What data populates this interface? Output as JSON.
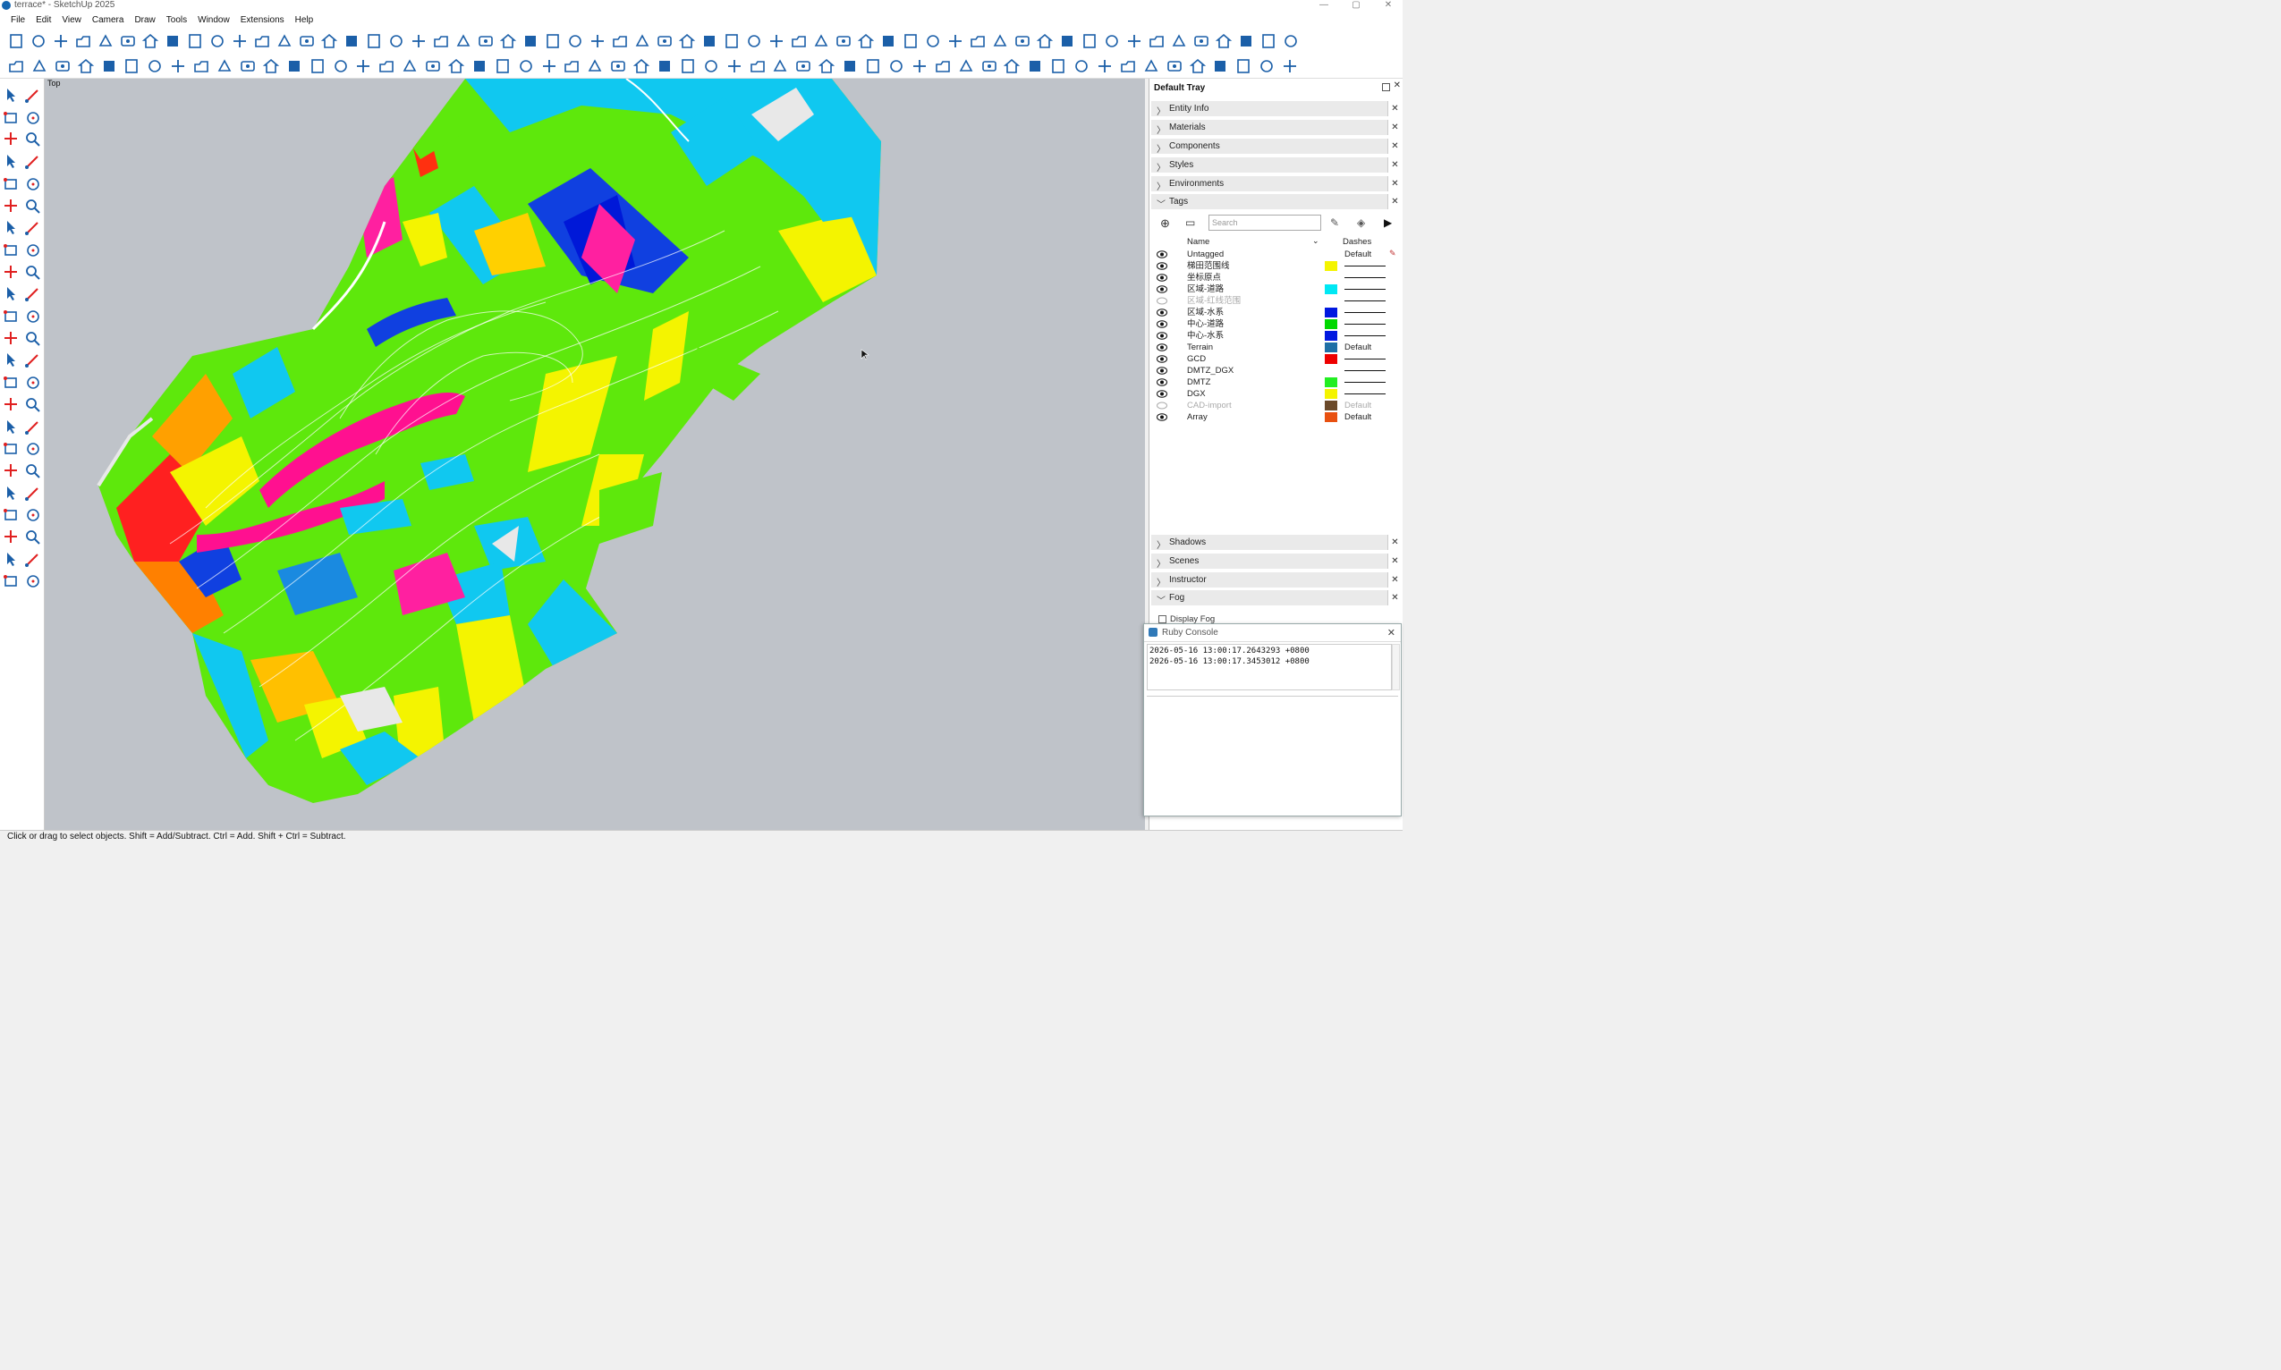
{
  "window": {
    "title": "terrace* - SketchUp 2025"
  },
  "menu": [
    "File",
    "Edit",
    "View",
    "Camera",
    "Draw",
    "Tools",
    "Window",
    "Extensions",
    "Help"
  ],
  "viewport": {
    "view_label": "Top"
  },
  "tray": {
    "title": "Default Tray",
    "panels_top": [
      "Entity Info",
      "Materials",
      "Components",
      "Styles",
      "Environments"
    ],
    "tags_panel": "Tags",
    "search_placeholder": "Search",
    "col_name": "Name",
    "col_dashes": "Dashes",
    "tags": [
      {
        "name": "Untagged",
        "visible": true,
        "color": "",
        "dashes": "Default"
      },
      {
        "name": "梯田范围线",
        "visible": true,
        "color": "#f4f400",
        "dashes": ""
      },
      {
        "name": "坐标原点",
        "visible": true,
        "color": "",
        "dashes": ""
      },
      {
        "name": "区域-道路",
        "visible": true,
        "color": "#00e8f4",
        "dashes": ""
      },
      {
        "name": "区域-红线范围",
        "visible": false,
        "color": "",
        "dashes": ""
      },
      {
        "name": "区域-水系",
        "visible": true,
        "color": "#0018e0",
        "dashes": ""
      },
      {
        "name": "中心-道路",
        "visible": true,
        "color": "#00d800",
        "dashes": ""
      },
      {
        "name": "中心-水系",
        "visible": true,
        "color": "#0018e0",
        "dashes": ""
      },
      {
        "name": "Terrain",
        "visible": true,
        "color": "#1e6fa6",
        "dashes": "Default"
      },
      {
        "name": "GCD",
        "visible": true,
        "color": "#ee0000",
        "dashes": ""
      },
      {
        "name": "DMTZ_DGX",
        "visible": true,
        "color": "",
        "dashes": ""
      },
      {
        "name": "DMTZ",
        "visible": true,
        "color": "#22ee22",
        "dashes": ""
      },
      {
        "name": "DGX",
        "visible": true,
        "color": "#f4f400",
        "dashes": ""
      },
      {
        "name": "CAD-import",
        "visible": false,
        "color": "#6b4a2a",
        "dashes": "Default"
      },
      {
        "name": "Array",
        "visible": true,
        "color": "#e85010",
        "dashes": "Default"
      }
    ],
    "panels_bottom": [
      "Shadows",
      "Scenes",
      "Instructor",
      "Fog"
    ],
    "fog_checkbox": "Display Fog"
  },
  "ruby_console": {
    "title": "Ruby Console",
    "lines": [
      "2026-05-16 13:00:17.2643293 +0800",
      "2026-05-16 13:00:17.3453012 +0800"
    ]
  },
  "status": "Click or drag to select objects. Shift = Add/Subtract. Ctrl = Add. Shift + Ctrl = Subtract."
}
